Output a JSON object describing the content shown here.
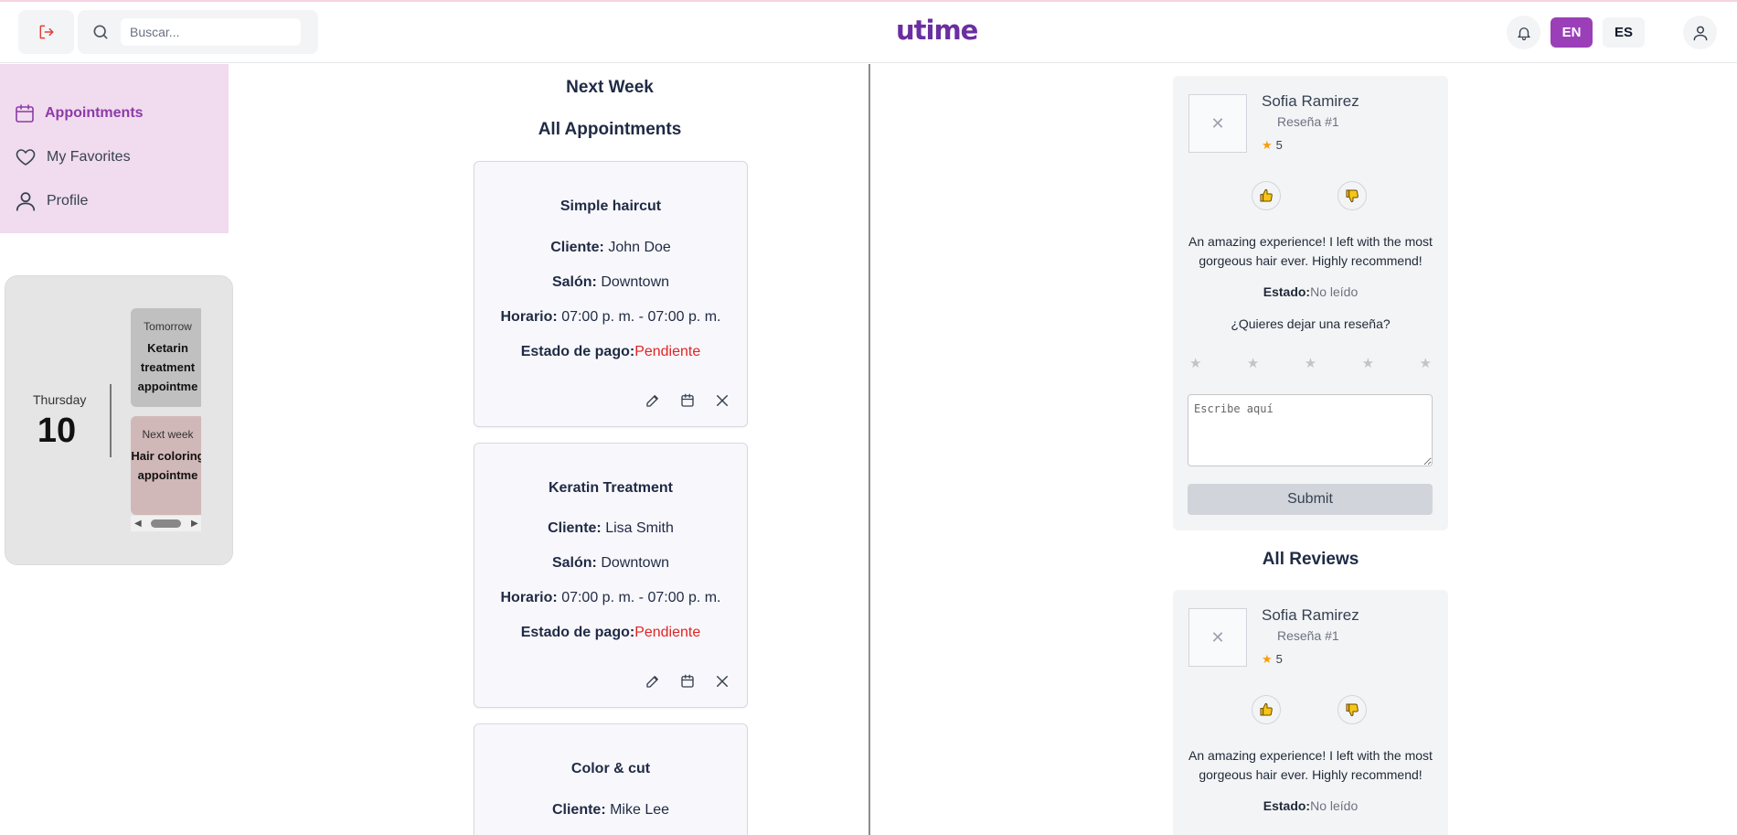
{
  "header": {
    "search_placeholder": "Buscar...",
    "logo": "utime",
    "lang_en": "EN",
    "lang_es": "ES"
  },
  "sidebar": {
    "items": [
      {
        "label": "Appointments",
        "icon": "calendar-icon",
        "active": true
      },
      {
        "label": "My Favorites",
        "icon": "heart-icon",
        "active": false
      },
      {
        "label": "Profile",
        "icon": "user-icon",
        "active": false
      }
    ]
  },
  "calendar_widget": {
    "day_name": "Thursday",
    "day_number": "10",
    "events": [
      {
        "when": "Tomorrow",
        "title": "Ketarin treatment appointme"
      },
      {
        "when": "Next week",
        "title": "Hair coloring appointme"
      }
    ]
  },
  "appointments": {
    "heading_week": "Next Week",
    "heading_all": "All Appointments",
    "labels": {
      "client": "Cliente:",
      "salon": "Salón:",
      "time": "Horario:",
      "payment": "Estado de pago:"
    },
    "items": [
      {
        "title": "Simple haircut",
        "client": "John Doe",
        "salon": "Downtown",
        "time": "07:00 p. m. - 07:00 p. m.",
        "payment_status": "Pendiente"
      },
      {
        "title": "Keratin Treatment",
        "client": "Lisa Smith",
        "salon": "Downtown",
        "time": "07:00 p. m. - 07:00 p. m.",
        "payment_status": "Pendiente"
      },
      {
        "title": "Color & cut",
        "client": "Mike Lee"
      }
    ]
  },
  "reviews": {
    "form_card": {
      "name": "Sofia Ramirez",
      "subtitle": "Reseña #1",
      "rating": "5",
      "text": "An amazing experience! I left with the most gorgeous hair ever. Highly recommend!",
      "status_label": "Estado:",
      "status_value": "No leído",
      "question": "¿Quieres dejar una reseña?",
      "textarea_placeholder": "Escribe aquí",
      "submit_label": "Submit"
    },
    "all_heading": "All Reviews",
    "list": [
      {
        "name": "Sofia Ramirez",
        "subtitle": "Reseña #1",
        "rating": "5",
        "text": "An amazing experience! I left with the most gorgeous hair ever. Highly recommend!",
        "status_label": "Estado:",
        "status_value": "No leído"
      }
    ]
  },
  "colors": {
    "brand": "#9b3fb8",
    "sidebar_bg": "#f0dcee",
    "pending": "#e02424",
    "logout": "#e0403a"
  }
}
